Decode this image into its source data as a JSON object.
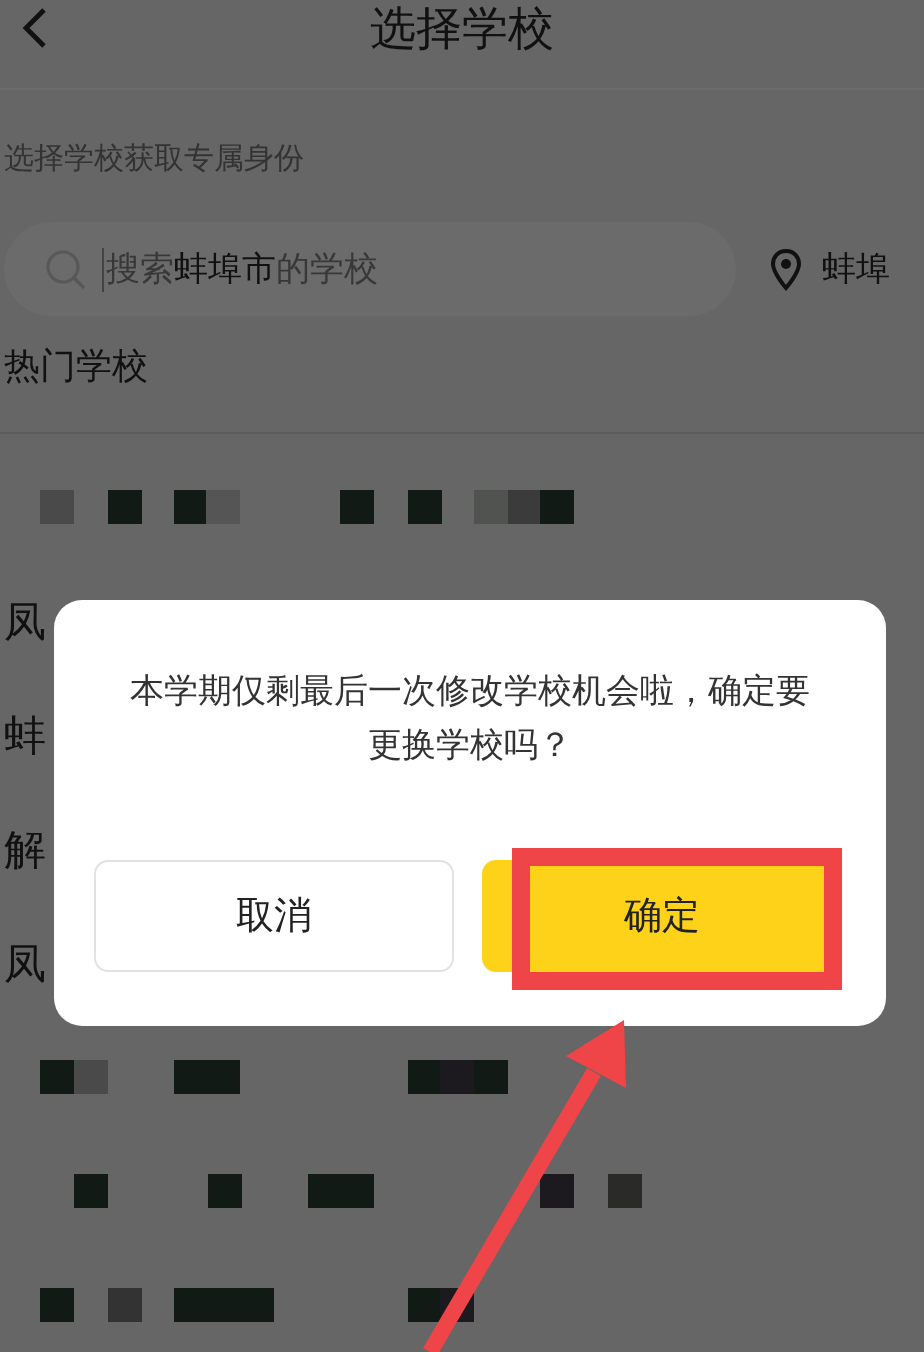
{
  "header": {
    "title": "选择学校"
  },
  "subtitle": "选择学校获取专属身份",
  "search": {
    "placeholder": "搜索**蚌埠市**的学校",
    "location": "蚌埠"
  },
  "section_title": "热门学校",
  "list_items": [
    "凤",
    "蚌",
    "解",
    "凤"
  ],
  "dialog": {
    "message": "本学期仅剩最后一次修改学校机会啦，确定要更换学校吗？",
    "buttons": [
      {
        "label": "取消",
        "kind": "secondary"
      },
      {
        "label": "确定",
        "kind": "primary"
      }
    ]
  },
  "annotations": {
    "highlight_box": true,
    "arrow": true
  }
}
